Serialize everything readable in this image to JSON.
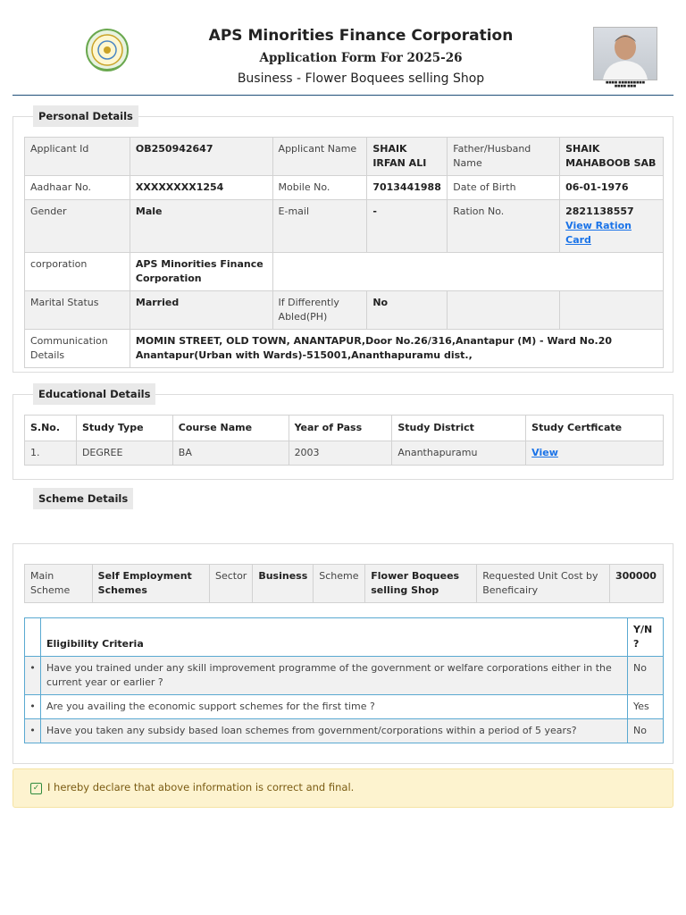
{
  "header": {
    "title": "APS Minorities Finance Corporation",
    "subtitle": "Application Form For 2025-26",
    "scheme_line": "Business - Flower Boquees selling Shop"
  },
  "personal": {
    "legend": "Personal Details",
    "labels": {
      "applicant_id": "Applicant Id",
      "applicant_name": "Applicant Name",
      "father": "Father/Husband Name",
      "aadhaar": "Aadhaar No.",
      "mobile": "Mobile No.",
      "dob": "Date of Birth",
      "gender": "Gender",
      "email": "E-mail",
      "ration": "Ration No.",
      "corporation": "corporation",
      "marital": "Marital Status",
      "ph": "If Differently Abled(PH)",
      "comm": "Communication Details"
    },
    "values": {
      "applicant_id": "OB250942647",
      "applicant_name": "SHAIK IRFAN ALI",
      "father": "SHAIK MAHABOOB SAB",
      "aadhaar": "XXXXXXXX1254",
      "mobile": "7013441988",
      "dob": "06-01-1976",
      "gender": "Male",
      "email": "-",
      "ration": "2821138557",
      "ration_link": "View Ration Card",
      "corporation": "APS Minorities Finance Corporation",
      "marital": "Married",
      "ph": "No",
      "comm": "MOMIN STREET, OLD TOWN, ANANTAPUR,Door No.26/316,Anantapur (M) - Ward No.20 Anantapur(Urban with Wards)-515001,Ananthapuramu dist.,"
    }
  },
  "education": {
    "legend": "Educational Details",
    "headers": [
      "S.No.",
      "Study Type",
      "Course Name",
      "Year of Pass",
      "Study District",
      "Study Certficate"
    ],
    "rows": [
      {
        "sno": "1.",
        "type": "DEGREE",
        "course": "BA",
        "year": "2003",
        "district": "Ananthapuramu",
        "cert": "View"
      }
    ]
  },
  "scheme": {
    "legend": "Scheme Details",
    "labels": {
      "main": "Main Scheme",
      "sector": "Sector",
      "scheme": "Scheme",
      "cost": "Requested Unit Cost by Beneficairy"
    },
    "values": {
      "main": "Self Employment Schemes",
      "sector": "Business",
      "scheme": "Flower Boquees selling Shop",
      "cost": "300000"
    },
    "eligibility": {
      "header": "Eligibility Criteria",
      "yn_header": "Y/N ?",
      "rows": [
        {
          "bullet": "•",
          "q": "Have you trained under any skill improvement programme of the government or welfare corporations either in the current year or earlier ?",
          "a": "No"
        },
        {
          "bullet": "•",
          "q": "Are you availing the economic support schemes for the first time ?",
          "a": "Yes"
        },
        {
          "bullet": "•",
          "q": "Have you taken any subsidy based loan schemes from government/corporations within a period of 5 years?",
          "a": "No"
        }
      ]
    }
  },
  "declaration": {
    "text": "I hereby declare that above information is correct and final.",
    "check": "✓"
  },
  "colors": {
    "link": "#1a73e8",
    "declaration_bg": "#fdf3cf",
    "eligibility_border": "#5aa9d1"
  }
}
